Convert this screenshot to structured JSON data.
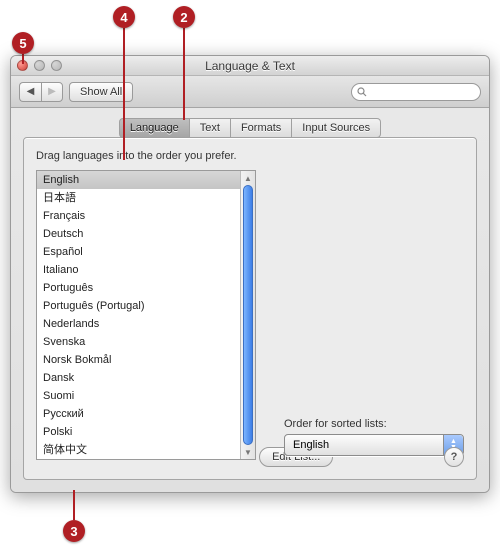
{
  "window": {
    "title": "Language & Text"
  },
  "toolbar": {
    "showall_label": "Show All",
    "search_placeholder": ""
  },
  "tabs": [
    {
      "label": "Language",
      "selected": true
    },
    {
      "label": "Text",
      "selected": false
    },
    {
      "label": "Formats",
      "selected": false
    },
    {
      "label": "Input Sources",
      "selected": false
    }
  ],
  "panel": {
    "hint": "Drag languages into the order you prefer.",
    "languages": [
      "English",
      "日本語",
      "Français",
      "Deutsch",
      "Español",
      "Italiano",
      "Português",
      "Português (Portugal)",
      "Nederlands",
      "Svenska",
      "Norsk Bokmål",
      "Dansk",
      "Suomi",
      "Русский",
      "Polski",
      "简体中文"
    ],
    "selected_index": 0,
    "order_label": "Order for sorted lists:",
    "order_value": "English",
    "edit_list_label": "Edit List...",
    "help_label": "?"
  },
  "callouts": {
    "c2": "2",
    "c3": "3",
    "c4": "4",
    "c5": "5"
  }
}
